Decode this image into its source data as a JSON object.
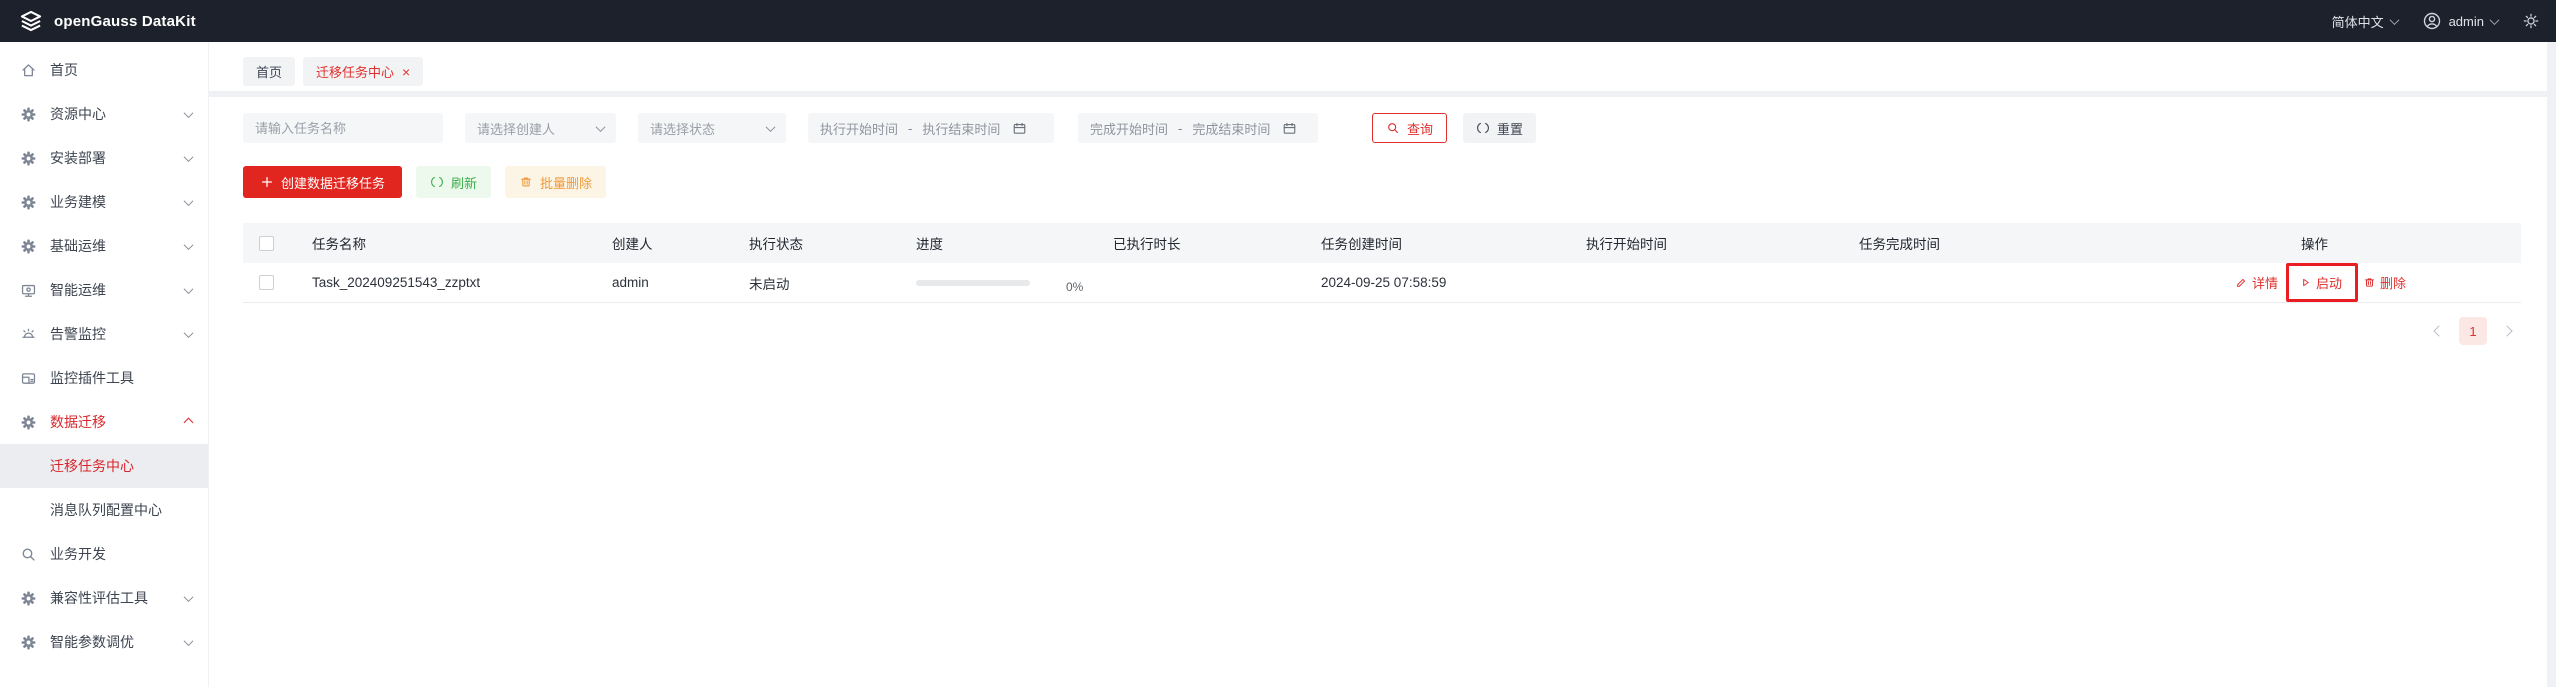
{
  "topbar": {
    "brand": "openGauss DataKit",
    "language": "简体中文",
    "username": "admin"
  },
  "sidebar": {
    "items": [
      {
        "label": "首页",
        "icon": "home-icon"
      },
      {
        "label": "资源中心",
        "icon": "gear-icon",
        "expandable": true
      },
      {
        "label": "安装部署",
        "icon": "gear-icon",
        "expandable": true
      },
      {
        "label": "业务建模",
        "icon": "gear-icon",
        "expandable": true
      },
      {
        "label": "基础运维",
        "icon": "gear-icon",
        "expandable": true
      },
      {
        "label": "智能运维",
        "icon": "monitor-icon",
        "expandable": true
      },
      {
        "label": "告警监控",
        "icon": "alarm-icon",
        "expandable": true
      },
      {
        "label": "监控插件工具",
        "icon": "plugin-icon"
      },
      {
        "label": "数据迁移",
        "icon": "gear-icon",
        "expandable": true,
        "expanded": true,
        "active": true
      },
      {
        "label": "迁移任务中心",
        "submenu": true,
        "active": true
      },
      {
        "label": "消息队列配置中心",
        "submenu": true
      },
      {
        "label": "业务开发",
        "icon": "search-icon"
      },
      {
        "label": "兼容性评估工具",
        "icon": "gear-icon",
        "expandable": true
      },
      {
        "label": "智能参数调优",
        "icon": "gear-icon",
        "expandable": true
      }
    ]
  },
  "tabs": [
    {
      "label": "首页"
    },
    {
      "label": "迁移任务中心",
      "close": "×",
      "active": true
    }
  ],
  "filters": {
    "task_name_placeholder": "请输入任务名称",
    "creator_placeholder": "请选择创建人",
    "status_placeholder": "请选择状态",
    "exec_start_placeholder": "执行开始时间",
    "exec_end_placeholder": "执行结束时间",
    "finish_start_placeholder": "完成开始时间",
    "finish_end_placeholder": "完成结束时间",
    "range_separator": "-",
    "query_label": "查询",
    "reset_label": "重置"
  },
  "toolbar": {
    "create_label": "创建数据迁移任务",
    "refresh_label": "刷新",
    "batch_delete_label": "批量删除"
  },
  "table": {
    "columns": [
      "任务名称",
      "创建人",
      "执行状态",
      "进度",
      "已执行时长",
      "任务创建时间",
      "执行开始时间",
      "任务完成时间",
      "操作"
    ],
    "rows": [
      {
        "name": "Task_202409251543_zzptxt",
        "creator": "admin",
        "status": "未启动",
        "progress_value": 0,
        "progress_text": "0%",
        "duration": "",
        "created_at": "2024-09-25 07:58:59",
        "exec_start": "",
        "finished_at": ""
      }
    ],
    "row_actions": [
      {
        "label": "详情",
        "icon": "edit-icon"
      },
      {
        "label": "启动",
        "icon": "play-icon",
        "highlighted": true
      },
      {
        "label": "删除",
        "icon": "trash-icon"
      }
    ]
  },
  "pagination": {
    "current": "1"
  },
  "colors": {
    "topbar_bg": "#1d212b",
    "accent_red": "#e0302d",
    "primary_button_red": "#e1251f",
    "refresh_green": "#3eae4d",
    "batch_delete_orange": "#f09b3c",
    "highlight_box_red": "#ea1d25",
    "active_page_bg": "#fbe7e3",
    "table_header_bg": "#f5f6f8"
  }
}
